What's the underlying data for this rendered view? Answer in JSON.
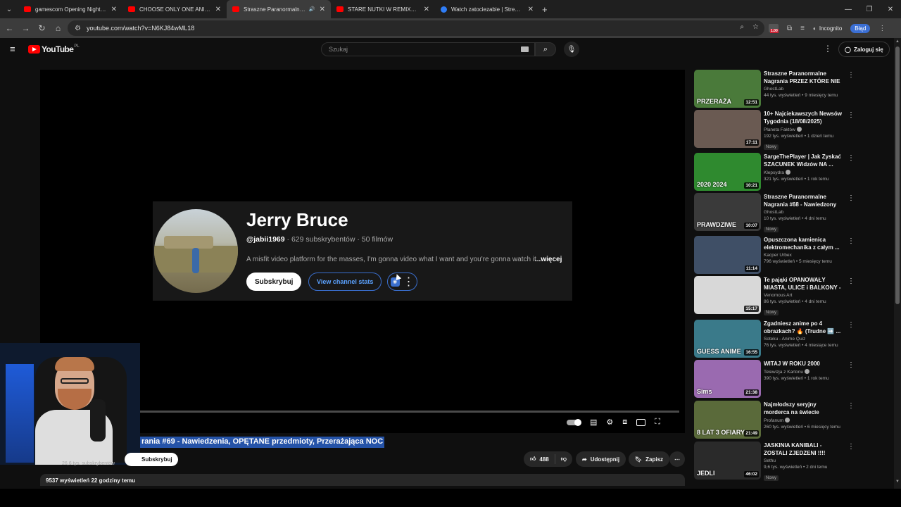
{
  "browser": {
    "tabs": [
      {
        "label": "gamescom Opening Night Live",
        "fav": "youtube-favicon"
      },
      {
        "label": "CHOOSE ONLY ONE ANIME OR...",
        "fav": "youtube-favicon"
      },
      {
        "label": "Straszne Paranormalne Nagr...",
        "fav": "youtube-favicon",
        "active": true
      },
      {
        "label": "STARE NUTKI W REMIXACH 🔥",
        "fav": "youtube-favicon"
      },
      {
        "label": "Watch zatociezabie | Streamals...",
        "fav": "streamals-favicon"
      }
    ],
    "url": "youtube.com/watch?v=N6KJ84wML18",
    "incognito_label": "Incognito",
    "error_label": "Błąd",
    "ext_badge": "1.00"
  },
  "yt": {
    "logo_text": "YouTube",
    "country": "PL",
    "search_placeholder": "Szukaj",
    "signin_label": "Zaloguj się"
  },
  "endcard": {
    "name": "Jerry Bruce",
    "handle": "@jabii1969",
    "meta": " · 629 subskrybentów · 50 filmów",
    "description": "A misfit video platform for the masses, I'm gonna video what I want and you're gonna watch it",
    "more_label": "...więcej",
    "subscribe_label": "Subskrybuj",
    "stats_label": "View channel stats"
  },
  "video": {
    "title_visible": "rania #69 - Nawiedzenia, OPĘTANE przedmioty, Przerażająca NOC",
    "owner_subs": "26,6 tys. subskrybentów",
    "subscribe_label": "Subskrybuj",
    "likes": "488",
    "share_label": "Udostępnij",
    "save_label": "Zapisz",
    "views_date": "9537 wyświetleń  22 godziny temu"
  },
  "recommendations": [
    {
      "title": "Straszne Paranormalne Nagrania PRZEZ KTÓRE NIE ...",
      "channel": "GhostLab",
      "meta": "44 tys. wyświetleń • 9 miesięcy temu",
      "duration": "12:51",
      "thumb_text": "PRZERAŻA",
      "bg": "#4a7a3a"
    },
    {
      "title": "10+ Najciekawszych Newsów Tygodnia (18/08/2025)",
      "channel": "Planeta Faktów",
      "meta": "192 tys. wyświetleń • 1 dzień temu",
      "badge": "Nowy",
      "duration": "17:11",
      "thumb_text": "",
      "bg": "#6a5a52",
      "verified": true
    },
    {
      "title": "SargeThePlayer | Jak Zyskać SZACUNEK Widzów NA ...",
      "channel": "Klepsydra",
      "meta": "321 tys. wyświetleń • 1 rok temu",
      "duration": "10:21",
      "thumb_text": "2020 2024",
      "bg": "#2f8a2f",
      "verified": true
    },
    {
      "title": "Straszne Paranormalne Nagrania #68 - Nawiedzony ...",
      "channel": "GhostLab",
      "meta": "10 tys. wyświetleń • 4 dni temu",
      "badge": "Nowy",
      "duration": "10:07",
      "thumb_text": "PRAWDZIWE",
      "bg": "#3a3a3a"
    },
    {
      "title": "Opuszczona kamienica elektromechanika z całym ...",
      "channel": "Kacper Urbex",
      "meta": "796 wyświetleń • 5 miesięcy temu",
      "duration": "11:14",
      "thumb_text": "",
      "bg": "#3f4f66"
    },
    {
      "title": "Te pająki OPANOWAŁY MIASTA, ULICE i BALKONY - czy są ...",
      "channel": "Venomous Art",
      "meta": "86 tys. wyświetleń • 4 dni temu",
      "badge": "Nowy",
      "duration": "15:17",
      "thumb_text": "",
      "bg": "#d8d8d8"
    },
    {
      "title": "Zgadniesz anime po 4 obrazkach? 🔥 (Trudne ➡️ ...",
      "channel": "Soteku - Anime Quiz",
      "meta": "76 tys. wyświetleń • 4 miesiące temu",
      "duration": "16:55",
      "thumb_text": "GUESS ANIME",
      "bg": "#3a7a8a"
    },
    {
      "title": "WITAJ W ROKU 2000",
      "channel": "Telewizja z Kartonu",
      "meta": "390 tys. wyświetleń • 1 rok temu",
      "duration": "21:38",
      "thumb_text": "Sims",
      "bg": "#9a6ab0",
      "verified": true
    },
    {
      "title": "Najmłodszy seryjny morderca na świecie",
      "channel": "Profanum",
      "meta": "260 tys. wyświetleń • 6 miesięcy temu",
      "duration": "21:49",
      "thumb_text": "8 LAT 3 OFIARY",
      "bg": "#5a6a3a",
      "verified": true
    },
    {
      "title": "JASKINIA KANIBALI -ZOSTALI ZJEDZENI !!!!",
      "channel": "Sethu",
      "meta": "9,6 tys. wyświetleń • 2 dni temu",
      "badge": "Nowy",
      "duration": "46:02",
      "thumb_text": "JEDLI",
      "bg": "#2a2a2a"
    }
  ]
}
